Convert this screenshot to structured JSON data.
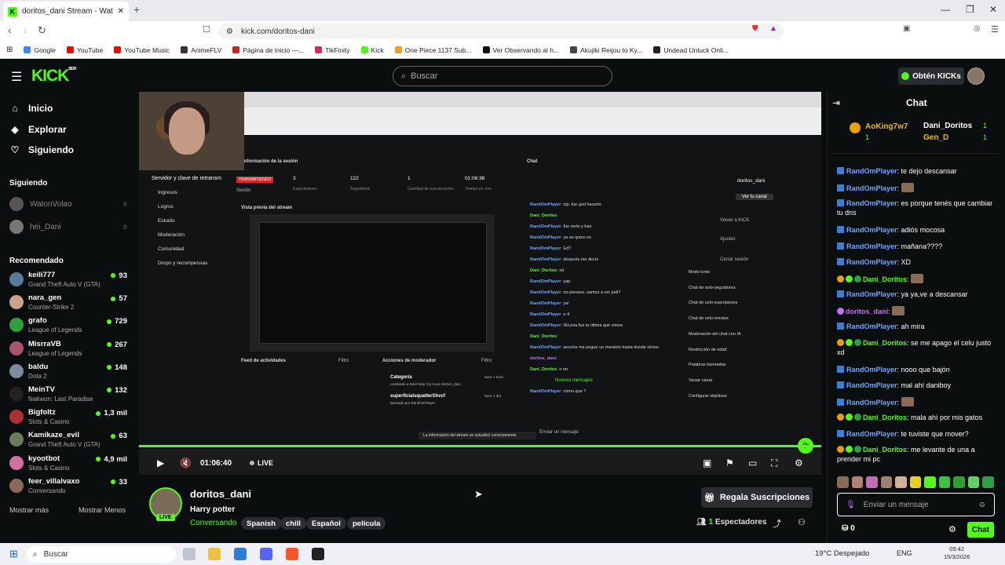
{
  "browser": {
    "tab_title": "doritos_dani Stream - Watch Liv...",
    "url": "kick.com/doritos-dani",
    "bookmarks": [
      {
        "label": "Google",
        "color": "#4285f4"
      },
      {
        "label": "YouTube",
        "color": "#ff0000"
      },
      {
        "label": "YouTube Music",
        "color": "#ff0000"
      },
      {
        "label": "AnimeFLV",
        "color": "#333333"
      },
      {
        "label": "Página de inicio —...",
        "color": "#cc2222"
      },
      {
        "label": "TikFinity",
        "color": "#e0245e"
      },
      {
        "label": "Kick",
        "color": "#53fc18"
      },
      {
        "label": "One Piece 1137 Sub...",
        "color": "#f0a020"
      },
      {
        "label": "Ver Observando al h...",
        "color": "#111111"
      },
      {
        "label": "Akujiki Reijou to Ky...",
        "color": "#444444"
      },
      {
        "label": "Undead Unluck Onli...",
        "color": "#222222"
      }
    ]
  },
  "header": {
    "logo": "KICK",
    "logo_sup": "BETA",
    "search_placeholder": "Buscar",
    "kicks_button": "Obtén KICKs"
  },
  "sidebar": {
    "nav": [
      {
        "label": "Inicio",
        "icon": "home-icon"
      },
      {
        "label": "Explorar",
        "icon": "compass-icon"
      },
      {
        "label": "Siguiendo",
        "icon": "heart-icon"
      }
    ],
    "following_heading": "Siguiendo",
    "following": [
      {
        "name": "WatonVolao",
        "status": "offline"
      },
      {
        "name": "hei_Dani",
        "status": "offline"
      }
    ],
    "recommended_heading": "Recomendado",
    "recommended": [
      {
        "name": "keili777",
        "game": "Grand Theft Auto V (GTA)",
        "viewers": "93",
        "color": "#5a7a9a"
      },
      {
        "name": "nara_gen",
        "game": "Counter-Strike 2",
        "viewers": "57",
        "color": "#c9a28a"
      },
      {
        "name": "grafo",
        "game": "League of Legends",
        "viewers": "729",
        "color": "#2ea043"
      },
      {
        "name": "MisrraVB",
        "game": "League of Legends",
        "viewers": "267",
        "color": "#a8566b"
      },
      {
        "name": "baldu",
        "game": "Dota 2",
        "viewers": "148",
        "color": "#7d8ba0"
      },
      {
        "name": "MeinTV",
        "game": "Nakwon: Last Paradise",
        "viewers": "132",
        "color": "#222222"
      },
      {
        "name": "Bigfoltz",
        "game": "Slots & Casino",
        "viewers": "1,3 mil",
        "color": "#b03030"
      },
      {
        "name": "Kamikaze_evil",
        "game": "Grand Theft Auto V (GTA)",
        "viewers": "63",
        "color": "#6a7a5a"
      },
      {
        "name": "kyootbot",
        "game": "Slots & Casino",
        "viewers": "4,9 mil",
        "color": "#d070a0"
      },
      {
        "name": "feer_villalvaxo",
        "game": "Conversando",
        "viewers": "33",
        "color": "#8a6a5a"
      }
    ],
    "show_more": "Mostrar más",
    "show_less": "Mostrar Menos"
  },
  "player": {
    "time": "01:06:40",
    "live_label": "LIVE",
    "progress": 1.0
  },
  "stream_dashboard": {
    "session_info_title": "Información de la sesión",
    "broadcasting_badge": "TRANSMITIENDO",
    "server_key": "Servidor y clave de retransm",
    "stats": [
      {
        "value": "3",
        "label": "Espectadores"
      },
      {
        "value": "122",
        "label": "Seguidores"
      },
      {
        "value": "1",
        "label": "Cantidad de suscripciones"
      },
      {
        "value": "01:06:38",
        "label": "Tiempo en vivo"
      }
    ],
    "session_label": "Sesión",
    "menu": [
      "Ingresos",
      "Logros",
      "Estudio",
      "Moderación",
      "Comunidad",
      "Drops y recompensas"
    ],
    "preview_title": "Vista previa del stream",
    "activity_title": "Feed de actividades",
    "filter_label": "Filtro",
    "mod_actions_title": "Acciones de moderador",
    "mod_actions": [
      {
        "title": "Categoría",
        "detail": "cambiado a Devil May Cry 5 por doritos_dani",
        "time": "hace 1 hora"
      },
      {
        "title": "superficialsquatterShvcf",
        "detail": "baneado por RandOmPlayer",
        "time": "hace 1 día"
      }
    ],
    "toast": "La información del stream se actualizó correctamente",
    "chat_title": "Chat",
    "chat_lines": [
      {
        "user": "RandOmPlayer",
        "text": "sip, fue god hacerlo"
      },
      {
        "user": "Dani_Doritos",
        "text": ""
      },
      {
        "user": "RandOmPlayer",
        "text": "fue verlo y ban"
      },
      {
        "user": "RandOmPlayer",
        "text": "ya se quien es"
      },
      {
        "user": "RandOmPlayer",
        "text": "Ed?"
      },
      {
        "user": "RandOmPlayer",
        "text": "después me decís"
      },
      {
        "user": "Dani_Doritos",
        "text": "xd"
      },
      {
        "user": "RandOmPlayer",
        "text": "yap"
      },
      {
        "user": "RandOmPlayer",
        "text": "no pienses, vamos a ver peli?"
      },
      {
        "user": "RandOmPlayer",
        "text": "ya!"
      },
      {
        "user": "RandOmPlayer",
        "text": "o 4"
      },
      {
        "user": "RandOmPlayer",
        "text": "Siii,esa fue la última que vimos"
      },
      {
        "user": "Dani_Doritos",
        "text": ""
      },
      {
        "user": "RandOmPlayer",
        "text": "anoche me pegue un maratón hasta donde vimos"
      },
      {
        "user": "doritos_dani",
        "text": ""
      },
      {
        "user": "Dani_Doritos",
        "text": "o no"
      }
    ],
    "new_messages": "Nuevos mensajes",
    "after_new": {
      "user": "RandOmPlayer",
      "text": "cómo que ?"
    },
    "chat_input": "Enviar un mensaje",
    "profile_name": "doritos_dani",
    "profile_button": "Ver tu canal",
    "profile_menu": [
      "Volver a KICK",
      "Ajustes",
      "Cerrar sesión"
    ],
    "settings": [
      "Modo lento",
      "Chat de solo-seguidores",
      "Chat de solo-suscriptores",
      "Chat de solo-emotes",
      "Moderación del chat con IA",
      "Restricción de edad",
      "Palabras baneadas",
      "Vaciar canal",
      "Configurar objetivos"
    ]
  },
  "channel": {
    "name": "doritos_dani",
    "title": "Harry potter",
    "live_badge": "LIVE",
    "category": "Conversando",
    "tags": [
      "Spanish",
      "chill",
      "Español",
      "película"
    ],
    "subs_button": "Regala Suscripciones",
    "viewers_count": "1",
    "viewers_label": "Espectadores"
  },
  "chat": {
    "title": "Chat",
    "pinned": [
      {
        "name": "AoKing7w7",
        "count": "1"
      },
      {
        "name": "Dani_Doritos",
        "count": "1"
      },
      {
        "name": "Gen_D",
        "count": "1"
      }
    ],
    "messages": [
      {
        "user": "RandOmPlayer",
        "type": "u",
        "text": "te dejo descansar",
        "emote": false
      },
      {
        "user": "RandOmPlayer",
        "type": "u",
        "text": "",
        "emote": true
      },
      {
        "user": "RandOmPlayer",
        "type": "u",
        "text": "es porque tenés que cambiar tu dns",
        "emote": false
      },
      {
        "user": "RandOmPlayer",
        "type": "u",
        "text": "adiós mocosa",
        "emote": false
      },
      {
        "user": "RandOmPlayer",
        "type": "u",
        "text": "mañana????",
        "emote": false
      },
      {
        "user": "RandOmPlayer",
        "type": "u",
        "text": "XD",
        "emote": false
      },
      {
        "user": "Dani_Doritos",
        "type": "g",
        "text": "",
        "emote": true
      },
      {
        "user": "RandOmPlayer",
        "type": "u",
        "text": "ya ya,ve a descansar",
        "emote": false
      },
      {
        "user": "doritos_dani",
        "type": "d",
        "text": "",
        "emote": true
      },
      {
        "user": "RandOmPlayer",
        "type": "u",
        "text": "ah mira",
        "emote": false
      },
      {
        "user": "Dani_Doritos",
        "type": "g",
        "text": "se me apago el celu justo xd",
        "emote": false
      },
      {
        "user": "RandOmPlayer",
        "type": "u",
        "text": "nooo que bajón",
        "emote": false
      },
      {
        "user": "RandOmPlayer",
        "type": "u",
        "text": "mal ahí daniboy",
        "emote": false
      },
      {
        "user": "RandOmPlayer",
        "type": "u",
        "text": "",
        "emote": true
      },
      {
        "user": "Dani_Doritos",
        "type": "g",
        "text": "mala ahí por mis gatos",
        "emote": false
      },
      {
        "user": "RandOmPlayer",
        "type": "u",
        "text": "te tuviste que mover?",
        "emote": false
      },
      {
        "user": "Dani_Doritos",
        "type": "g",
        "text": "me levante de una a prender mi pc",
        "emote": false
      }
    ],
    "input_placeholder": "Enviar un mensaje",
    "kick_count": "0",
    "send_button": "Chat"
  },
  "taskbar": {
    "search": "Buscar",
    "weather": "19°C Despejado",
    "lang": "ENG",
    "time": "05:42",
    "date": "15/3/2026"
  }
}
